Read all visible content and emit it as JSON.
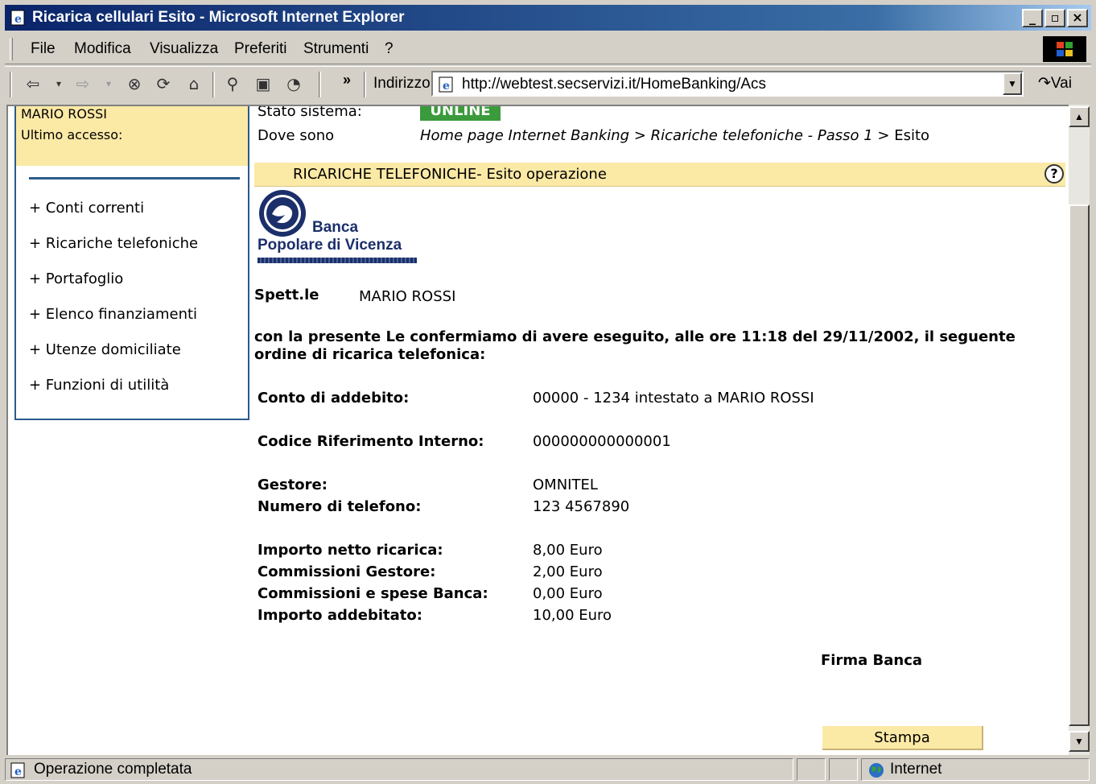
{
  "window": {
    "title": "Ricarica cellulari Esito - Microsoft Internet Explorer"
  },
  "menu": [
    "File",
    "Modifica",
    "Visualizza",
    "Preferiti",
    "Strumenti",
    "?"
  ],
  "toolbar": {
    "address_label": "Indirizzo",
    "url": "http://webtest.secservizi.it/HomeBanking/Acs",
    "go_label": "Vai",
    "more": "»"
  },
  "sidebar": {
    "user_name": "MARIO ROSSI",
    "last_access_label": "Ultimo accesso:",
    "items": [
      "+ Conti correnti",
      "+ Ricariche telefoniche",
      "+ Portafoglio",
      "+ Elenco finanziamenti",
      "+ Utenze domiciliate",
      "+ Funzioni di utilità"
    ]
  },
  "main": {
    "stato_label": "Stato sistema:",
    "stato_value": "UNLINE",
    "dove_label": "Dove sono",
    "breadcrumb_italic": "Home page Internet Banking > Ricariche telefoniche - Passo 1",
    "breadcrumb_last": "> Esito",
    "header": "RICARICHE TELEFONICHE- Esito operazione",
    "help": "?",
    "logo_line1": "Banca",
    "logo_line2": "Popolare di Vicenza",
    "spett_label": "Spett.le",
    "spett_value": "MARIO ROSSI",
    "confirm_text": "con la presente Le confermiamo di avere eseguito, alle ore 11:18 del 29/11/2002, il seguente ordine di ricarica telefonica:",
    "rows": [
      {
        "label": "Conto di addebito:",
        "value": "00000 - 1234  intestato a MARIO ROSSI"
      },
      {
        "label": "Codice Riferimento Interno:",
        "value": "000000000000001"
      },
      {
        "label": "Gestore:",
        "value": "OMNITEL"
      },
      {
        "label": "Numero di telefono:",
        "value": "123 4567890"
      },
      {
        "label": "Importo netto ricarica:",
        "value": "8,00 Euro"
      },
      {
        "label": "Commissioni Gestore:",
        "value": "2,00 Euro"
      },
      {
        "label": "Commissioni e spese Banca:",
        "value": "0,00 Euro"
      },
      {
        "label": "Importo addebitato:",
        "value": "10,00 Euro"
      }
    ],
    "firma": "Firma Banca",
    "stampa": "Stampa"
  },
  "status": {
    "text": "Operazione completata",
    "zone": "Internet"
  },
  "colors": {
    "title_bar": "#0a246a",
    "panel_yellow": "#fbe9a6",
    "online_green": "#3b9a3b",
    "panel_border": "#2b5a8b"
  },
  "icons": [
    "ie-page-icon",
    "back-arrow-icon",
    "forward-arrow-icon",
    "stop-icon",
    "refresh-icon",
    "home-icon",
    "search-icon",
    "favorites-icon",
    "history-icon",
    "windows-flag-icon",
    "help-icon",
    "globe-icon"
  ]
}
